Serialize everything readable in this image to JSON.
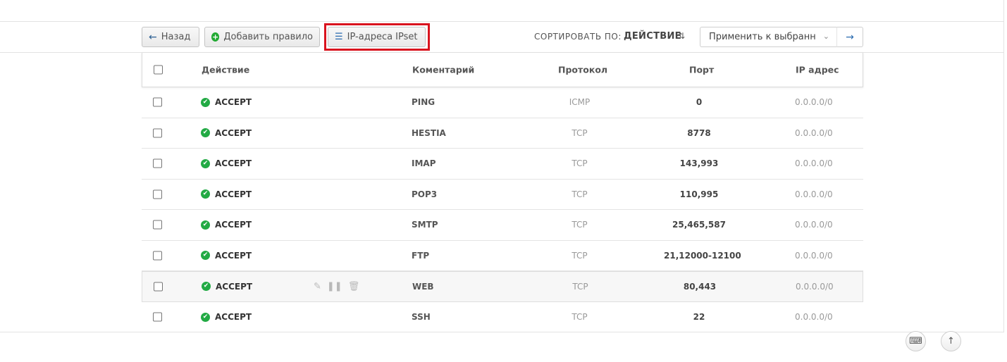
{
  "toolbar": {
    "back_label": "Назад",
    "add_rule_label": "Добавить правило",
    "ipset_label": "IP-адреса IPset",
    "sort_label": "СОРТИРОВАТЬ ПО:",
    "sort_value": "ДЕЙСТВИЕ",
    "apply_select_value": "Применить к выбранном"
  },
  "table": {
    "headers": {
      "action": "Действие",
      "comment": "Коментарий",
      "protocol": "Протокол",
      "port": "Порт",
      "ip": "IP адрес"
    },
    "rows": [
      {
        "action": "ACCEPT",
        "comment": "PING",
        "protocol": "ICMP",
        "port": "0",
        "ip": "0.0.0.0/0"
      },
      {
        "action": "ACCEPT",
        "comment": "HESTIA",
        "protocol": "TCP",
        "port": "8778",
        "ip": "0.0.0.0/0"
      },
      {
        "action": "ACCEPT",
        "comment": "IMAP",
        "protocol": "TCP",
        "port": "143,993",
        "ip": "0.0.0.0/0"
      },
      {
        "action": "ACCEPT",
        "comment": "POP3",
        "protocol": "TCP",
        "port": "110,995",
        "ip": "0.0.0.0/0"
      },
      {
        "action": "ACCEPT",
        "comment": "SMTP",
        "protocol": "TCP",
        "port": "25,465,587",
        "ip": "0.0.0.0/0"
      },
      {
        "action": "ACCEPT",
        "comment": "FTP",
        "protocol": "TCP",
        "port": "21,12000-12100",
        "ip": "0.0.0.0/0"
      },
      {
        "action": "ACCEPT",
        "comment": "WEB",
        "protocol": "TCP",
        "port": "80,443",
        "ip": "0.0.0.0/0"
      },
      {
        "action": "ACCEPT",
        "comment": "SSH",
        "protocol": "TCP",
        "port": "22",
        "ip": "0.0.0.0/0"
      }
    ]
  },
  "colors": {
    "accept_green": "#22aa44",
    "highlight_red": "#d9131e",
    "link_blue": "#2b6cb0"
  }
}
